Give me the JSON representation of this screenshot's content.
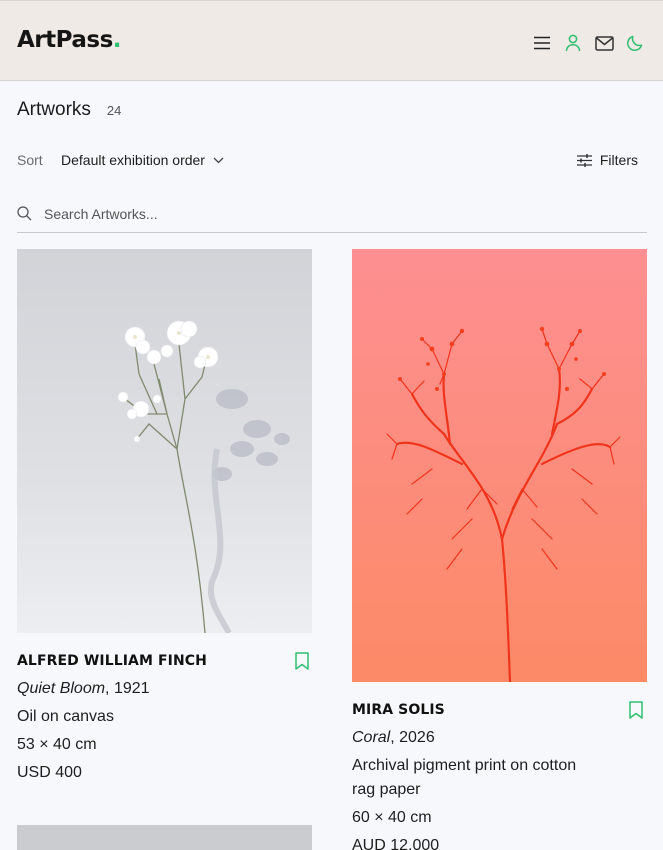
{
  "header": {
    "logo_text": "ArtPass",
    "logo_dot": ".",
    "accent_color": "#2fbf71",
    "icons": [
      "menu-icon",
      "user-icon",
      "mail-icon",
      "moon-icon"
    ]
  },
  "listing": {
    "title": "Artworks",
    "count": "24",
    "sort_label": "Sort",
    "sort_value": "Default exhibition order",
    "filters_label": "Filters"
  },
  "search": {
    "placeholder": "Search Artworks..."
  },
  "artworks": [
    {
      "artist": "ALFRED WILLIAM FINCH",
      "title": "Quiet Bloom",
      "year": ", 1921",
      "medium": "Oil on canvas",
      "dimensions": "53 × 40 cm",
      "price": "USD 400",
      "image": "white-flower-on-grey"
    },
    {
      "artist": "MIRA SOLIS",
      "title": "Coral",
      "year": ", 2026",
      "medium_line1": "Archival pigment print on cotton",
      "medium_line2": "rag paper",
      "dimensions": "60 × 40 cm",
      "price": "AUD 12,000",
      "image": "red-plant-on-coral"
    }
  ]
}
